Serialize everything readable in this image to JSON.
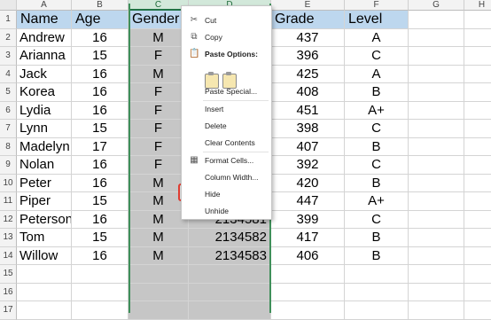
{
  "columns": [
    "A",
    "B",
    "C",
    "D",
    "E",
    "F",
    "G",
    "H"
  ],
  "row_numbers": [
    "1",
    "2",
    "3",
    "4",
    "5",
    "6",
    "7",
    "8",
    "9",
    "10",
    "11",
    "12",
    "13",
    "14",
    "15",
    "16",
    "17"
  ],
  "headers": {
    "name": "Name",
    "age": "Age",
    "gender": "Gender",
    "grade": "Grade",
    "level": "Level"
  },
  "rows": [
    {
      "name": "Andrew",
      "age": "16",
      "gender": "M",
      "id": "",
      "grade": "437",
      "level": "A"
    },
    {
      "name": "Arianna",
      "age": "15",
      "gender": "F",
      "id": "",
      "grade": "396",
      "level": "C"
    },
    {
      "name": "Jack",
      "age": "16",
      "gender": "M",
      "id": "",
      "grade": "425",
      "level": "A"
    },
    {
      "name": "Korea",
      "age": "16",
      "gender": "F",
      "id": "",
      "grade": "408",
      "level": "B"
    },
    {
      "name": "Lydia",
      "age": "16",
      "gender": "F",
      "id": "",
      "grade": "451",
      "level": "A+"
    },
    {
      "name": "Lynn",
      "age": "15",
      "gender": "F",
      "id": "",
      "grade": "398",
      "level": "C"
    },
    {
      "name": "Madelyn",
      "age": "17",
      "gender": "F",
      "id": "",
      "grade": "407",
      "level": "B"
    },
    {
      "name": "Nolan",
      "age": "16",
      "gender": "F",
      "id": "",
      "grade": "392",
      "level": "C"
    },
    {
      "name": "Peter",
      "age": "16",
      "gender": "M",
      "id": "",
      "grade": "420",
      "level": "B"
    },
    {
      "name": "Piper",
      "age": "15",
      "gender": "M",
      "id": "",
      "grade": "447",
      "level": "A+"
    },
    {
      "name": "Peterson",
      "age": "16",
      "gender": "M",
      "id": "2134581",
      "grade": "399",
      "level": "C"
    },
    {
      "name": "Tom",
      "age": "15",
      "gender": "M",
      "id": "2134582",
      "grade": "417",
      "level": "B"
    },
    {
      "name": "Willow",
      "age": "16",
      "gender": "M",
      "id": "2134583",
      "grade": "406",
      "level": "B"
    }
  ],
  "context_menu": {
    "cut": "Cut",
    "copy": "Copy",
    "paste_options": "Paste Options:",
    "paste_special": "Paste Special...",
    "insert": "Insert",
    "delete": "Delete",
    "clear_contents": "Clear Contents",
    "format_cells": "Format Cells...",
    "column_width": "Column Width...",
    "hide": "Hide",
    "unhide": "Unhide"
  },
  "colors": {
    "header_fill": "#bdd7ee",
    "selection_fill": "#c6c6c6",
    "selection_border": "#3f8f5a",
    "highlight_border": "#e03c31"
  },
  "icons": {
    "cut": "scissors-icon",
    "copy": "copy-icon",
    "paste": "clipboard-icon",
    "format_cells": "format-cells-icon"
  }
}
